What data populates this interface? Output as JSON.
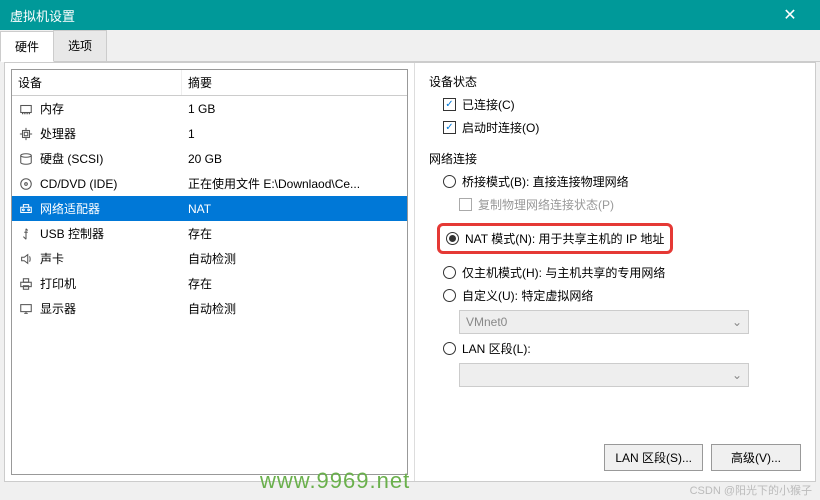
{
  "window": {
    "title": "虚拟机设置"
  },
  "tabs": {
    "hardware": "硬件",
    "options": "选项"
  },
  "hw_header": {
    "device": "设备",
    "summary": "摘要"
  },
  "hw": [
    {
      "icon": "memory",
      "name": "内存",
      "summary": "1 GB"
    },
    {
      "icon": "cpu",
      "name": "处理器",
      "summary": "1"
    },
    {
      "icon": "disk",
      "name": "硬盘 (SCSI)",
      "summary": "20 GB"
    },
    {
      "icon": "cd",
      "name": "CD/DVD (IDE)",
      "summary": "正在使用文件 E:\\Downlaod\\Ce..."
    },
    {
      "icon": "net",
      "name": "网络适配器",
      "summary": "NAT"
    },
    {
      "icon": "usb",
      "name": "USB 控制器",
      "summary": "存在"
    },
    {
      "icon": "sound",
      "name": "声卡",
      "summary": "自动检测"
    },
    {
      "icon": "printer",
      "name": "打印机",
      "summary": "存在"
    },
    {
      "icon": "display",
      "name": "显示器",
      "summary": "自动检测"
    }
  ],
  "dev_status": {
    "title": "设备状态",
    "connected": "已连接(C)",
    "connect_at_power": "启动时连接(O)"
  },
  "net_conn": {
    "title": "网络连接",
    "bridged": "桥接模式(B): 直接连接物理网络",
    "replicate": "复制物理网络连接状态(P)",
    "nat": "NAT 模式(N): 用于共享主机的 IP 地址",
    "hostonly": "仅主机模式(H): 与主机共享的专用网络",
    "custom": "自定义(U): 特定虚拟网络",
    "vmnet": "VMnet0",
    "lan": "LAN 区段(L):"
  },
  "buttons": {
    "lan_seg": "LAN 区段(S)...",
    "advanced": "高级(V)..."
  },
  "watermark": "www.9969.net",
  "csdn": "CSDN @阳光下的小猴子"
}
